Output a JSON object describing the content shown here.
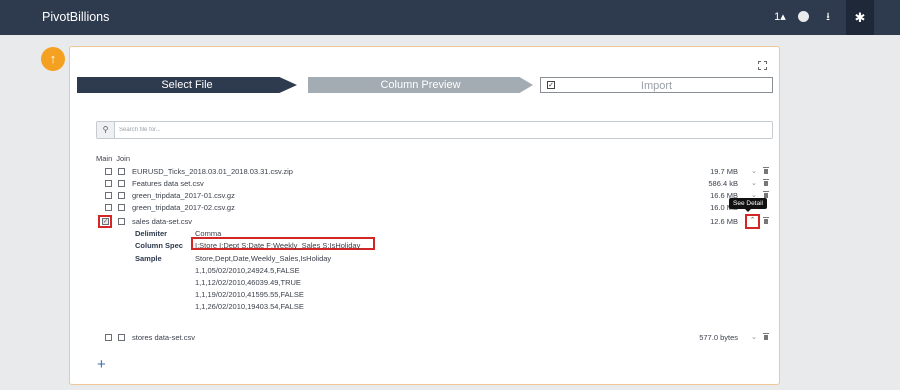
{
  "app": {
    "title": "PivotBillions"
  },
  "topbar": {
    "user_label": "1"
  },
  "steps": [
    {
      "label": "Select File"
    },
    {
      "label": "Column Preview"
    },
    {
      "label": "Import"
    }
  ],
  "search": {
    "placeholder": "Search file for..."
  },
  "columns": {
    "main": "Main",
    "join": "Join"
  },
  "files": [
    {
      "name": "EURUSD_Ticks_2018.03.01_2018.03.31.csv.zip",
      "size": "19.7 MB"
    },
    {
      "name": "Features data set.csv",
      "size": "586.4 kB"
    },
    {
      "name": "green_tripdata_2017-01.csv.gz",
      "size": "16.6 MB"
    },
    {
      "name": "green_tripdata_2017-02.csv.gz",
      "size": "16.0 MB"
    },
    {
      "name": "sales data-set.csv",
      "size": "12.6 MB"
    },
    {
      "name": "stores data-set.csv",
      "size": "577.0 bytes"
    }
  ],
  "tooltip": {
    "text": "See Detail"
  },
  "detail": {
    "delimiter_label": "Delimiter",
    "delimiter_value": "Comma",
    "spec_label": "Column Spec",
    "spec_value": "I:Store I:Dept S:Date F:Weekly_Sales S:IsHoliday",
    "sample_label": "Sample",
    "sample_lines": [
      "Store,Dept,Date,Weekly_Sales,IsHoliday",
      "1,1,05/02/2010,24924.5,FALSE",
      "1,1,12/02/2010,46039.49,TRUE",
      "1,1,19/02/2010,41595.55,FALSE",
      "1,1,26/02/2010,19403.54,FALSE"
    ]
  },
  "add_button": {
    "label": "+"
  }
}
